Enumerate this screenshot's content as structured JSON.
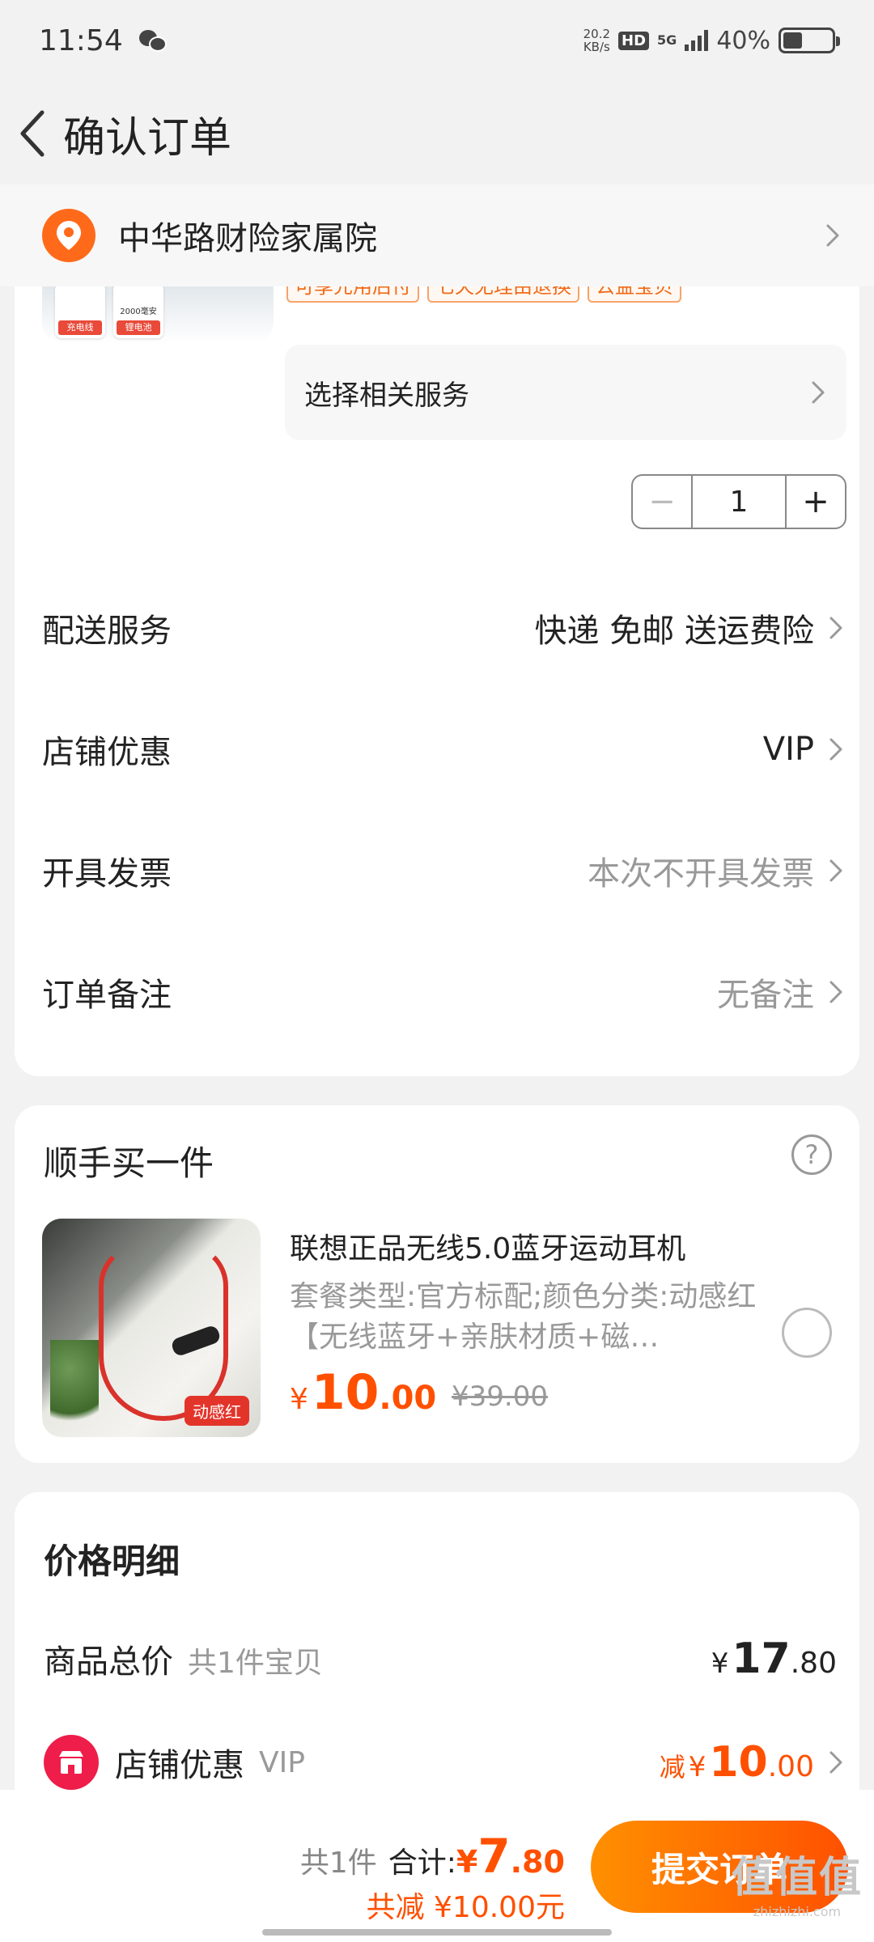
{
  "status_bar": {
    "time": "11:54",
    "net_speed_top": "20.2",
    "net_speed_bottom": "KB/s",
    "hd": "HD",
    "network": "5G",
    "battery": "40%"
  },
  "header": {
    "title": "确认订单"
  },
  "address": {
    "text": "中华路财险家属院"
  },
  "item": {
    "thumb_labels": [
      "充电线",
      "2000毫安",
      "锂电池"
    ],
    "tags": [
      "可享先用后付",
      "七天无理由退换",
      "公益宝贝"
    ],
    "service_label": "选择相关服务",
    "quantity": "1",
    "minus": "−",
    "plus": "+"
  },
  "rows": {
    "delivery": {
      "label": "配送服务",
      "value": "快递 免邮 送运费险"
    },
    "shop_discount": {
      "label": "店铺优惠",
      "value": "VIP"
    },
    "invoice": {
      "label": "开具发票",
      "value": "本次不开具发票"
    },
    "note": {
      "label": "订单备注",
      "value": "无备注"
    }
  },
  "addon": {
    "title": "顺手买一件",
    "help": "?",
    "product_name": "联想正品无线5.0蓝牙运动耳机",
    "product_desc": "套餐类型:官方标配;颜色分类:动感红【无线蓝牙+亲肤材质+磁…",
    "badge": "动感红",
    "price_yen": "¥",
    "price_int": "10",
    "price_dec": ".00",
    "old_price": "¥39.00"
  },
  "price_detail": {
    "title": "价格明细",
    "goods_total_label": "商品总价",
    "goods_count": "共1件宝贝",
    "goods_total_yen": "¥",
    "goods_total_int": "17",
    "goods_total_dec": ".80",
    "shop_discount_label": "店铺优惠",
    "shop_discount_sub": "VIP",
    "discount_prefix": "减",
    "discount_yen": "¥",
    "discount_int": "10",
    "discount_dec": ".00"
  },
  "bottom": {
    "count": "共1件",
    "total_label": "合计:",
    "total_yen": "¥",
    "total_int": "7",
    "total_dec": ".80",
    "saved": "共减 ¥10.00元",
    "submit": "提交订单"
  },
  "watermark": {
    "big": "值值值",
    "small": "zhizhizhi.com"
  },
  "colors": {
    "accent": "#ff5000",
    "accent_light": "#ff9000",
    "background": "#f2f2f2"
  }
}
